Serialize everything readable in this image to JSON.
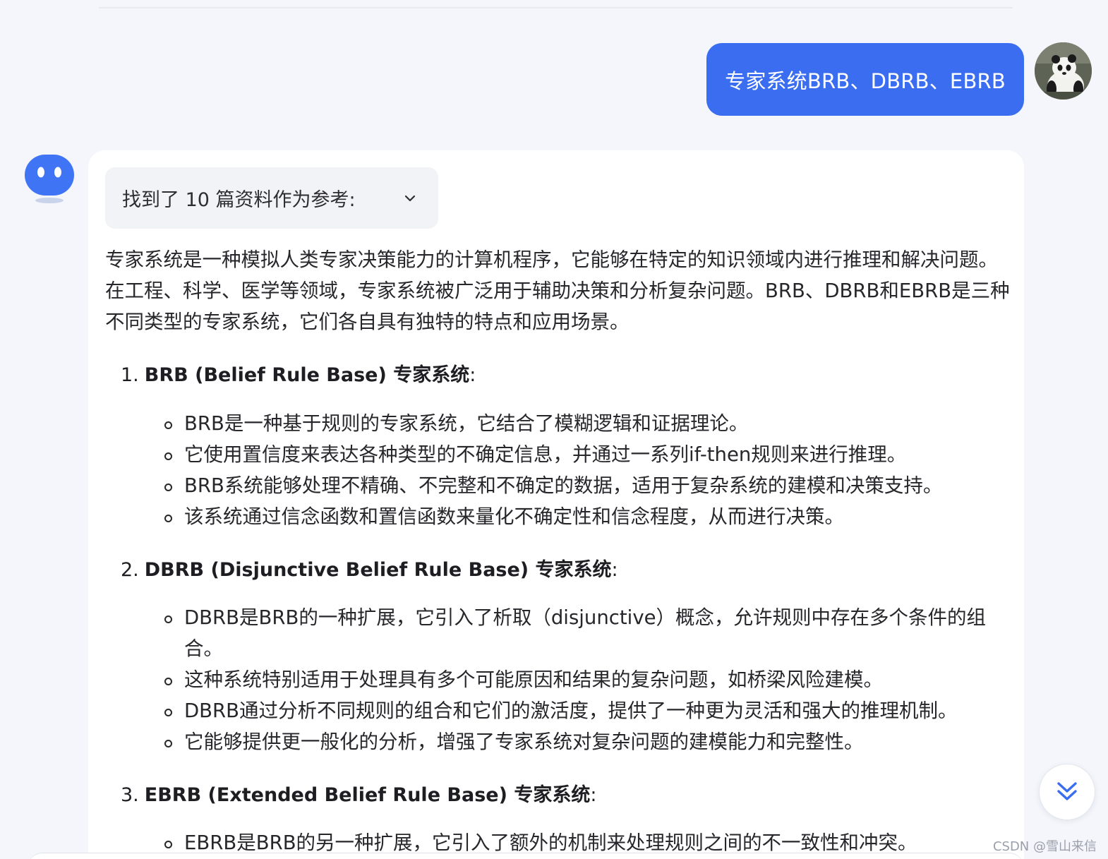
{
  "user_message": "专家系统BRB、DBRB、EBRB",
  "references": {
    "label": "找到了 10 篇资料作为参考:"
  },
  "answer": {
    "intro": "专家系统是一种模拟人类专家决策能力的计算机程序，它能够在特定的知识领域内进行推理和解决问题。在工程、科学、医学等领域，专家系统被广泛用于辅助决策和分析复杂问题。BRB、DBRB和EBRB是三种不同类型的专家系统，它们各自具有独特的特点和应用场景。",
    "sections": [
      {
        "number": "1.",
        "title": "BRB (Belief Rule Base) 专家系统",
        "colon": ":",
        "bullets": [
          "BRB是一种基于规则的专家系统，它结合了模糊逻辑和证据理论。",
          "它使用置信度来表达各种类型的不确定信息，并通过一系列if-then规则来进行推理。",
          "BRB系统能够处理不精确、不完整和不确定的数据，适用于复杂系统的建模和决策支持。",
          "该系统通过信念函数和置信函数来量化不确定性和信念程度，从而进行决策。"
        ]
      },
      {
        "number": "2.",
        "title": "DBRB (Disjunctive Belief Rule Base) 专家系统",
        "colon": ":",
        "bullets": [
          "DBRB是BRB的一种扩展，它引入了析取（disjunctive）概念，允许规则中存在多个条件的组合。",
          "这种系统特别适用于处理具有多个可能原因和结果的复杂问题，如桥梁风险建模。",
          "DBRB通过分析不同规则的组合和它们的激活度，提供了一种更为灵活和强大的推理机制。",
          "它能够提供更一般化的分析，增强了专家系统对复杂问题的建模能力和完整性。"
        ]
      },
      {
        "number": "3.",
        "title": "EBRB (Extended Belief Rule Base) 专家系统",
        "colon": ":",
        "bullets": [
          "EBRB是BRB的另一种扩展，它引入了额外的机制来处理规则之间的不一致性和冲突。"
        ]
      }
    ]
  },
  "icons": {
    "user_avatar": "panda-avatar-icon",
    "bot_avatar": "bot-face-icon",
    "refs_toggle": "chevron-down-icon",
    "scroll_down": "double-chevron-down-icon"
  },
  "colors": {
    "user_bubble": "#3b6df0",
    "bot_avatar": "#3f74f5",
    "page_bg": "#f4f6fb",
    "card_bg": "#ffffff"
  },
  "watermark": "CSDN @雪山来信"
}
